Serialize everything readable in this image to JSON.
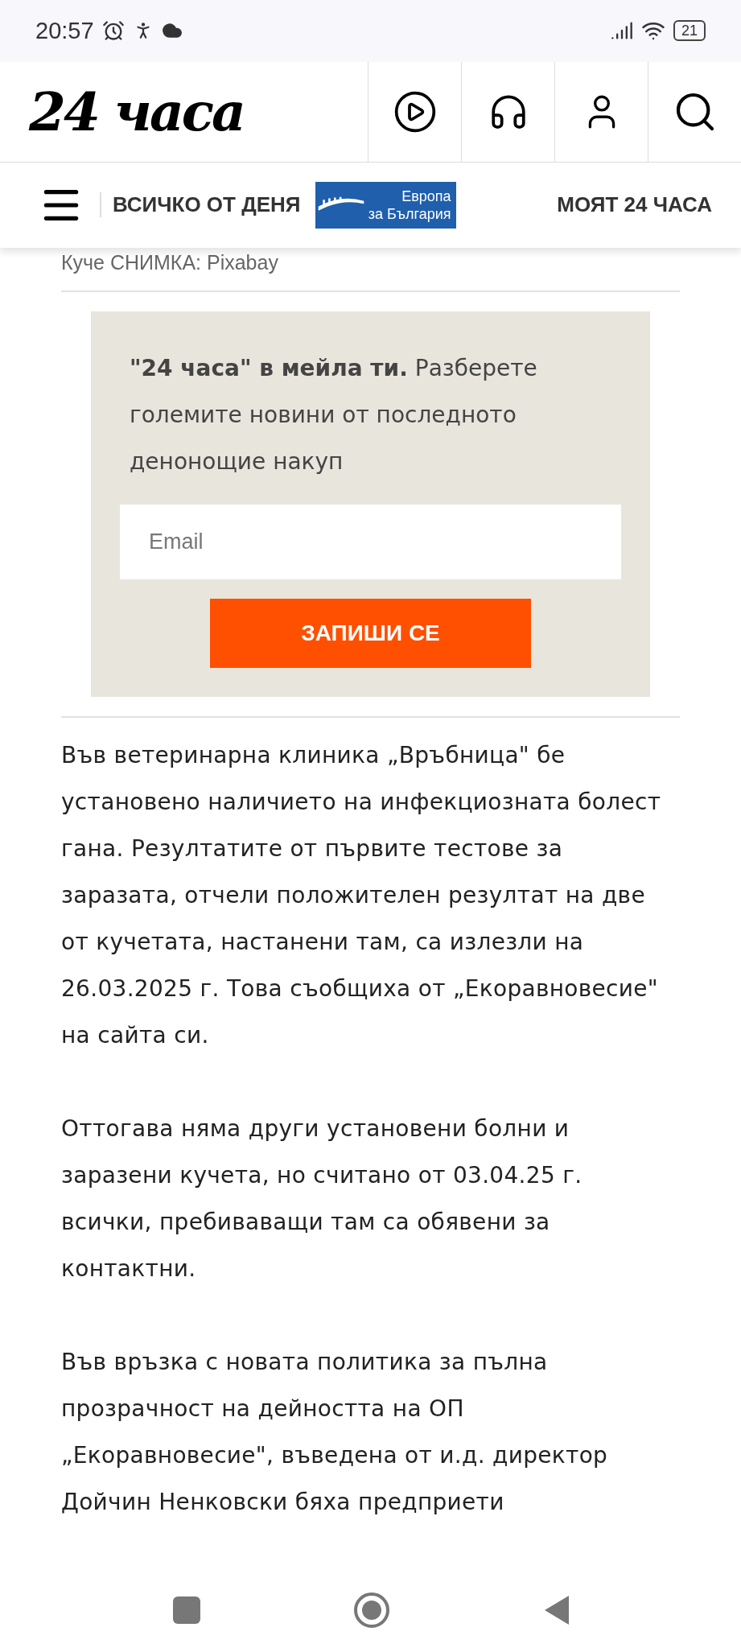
{
  "status_bar": {
    "time": "20:57",
    "battery": "21"
  },
  "header": {
    "logo": "24 часа"
  },
  "nav": {
    "link": "ВСИЧКО ОТ ДЕНЯ",
    "badge_lines": [
      "Европа",
      "за България"
    ],
    "right_link": "МОЯТ 24 ЧАСА"
  },
  "caption": "Куче СНИМКА: Pixabay",
  "newsletter": {
    "text": "**\"24 часа\" в мейла ти.** Разберете големите новини от последното денонощие накуп",
    "placeholder": "Email",
    "button": "ЗАПИШИ СЕ"
  },
  "paragraphs": [
    "Във ветеринарна клиника „Връбница\" бе установено наличието на инфекциозната болест гана. Резултатите от първите тестове за заразата, отчели положителен резултат на две от кучетата, настанени там, са излезли на 26.03.2025 г. Това съобщиха от „Екоравновесие\" на сайта си.",
    "Оттогава няма други установени болни и заразени кучета, но считано от 03.04.25 г. всички, пребиваващи там са обявени за контактни.",
    "Във връзка с новата политика за пълна прозрачност на дейността на ОП „Екоравновесие\", въведена от и.д. директор Дойчин Ненковски бяха предприети"
  ]
}
